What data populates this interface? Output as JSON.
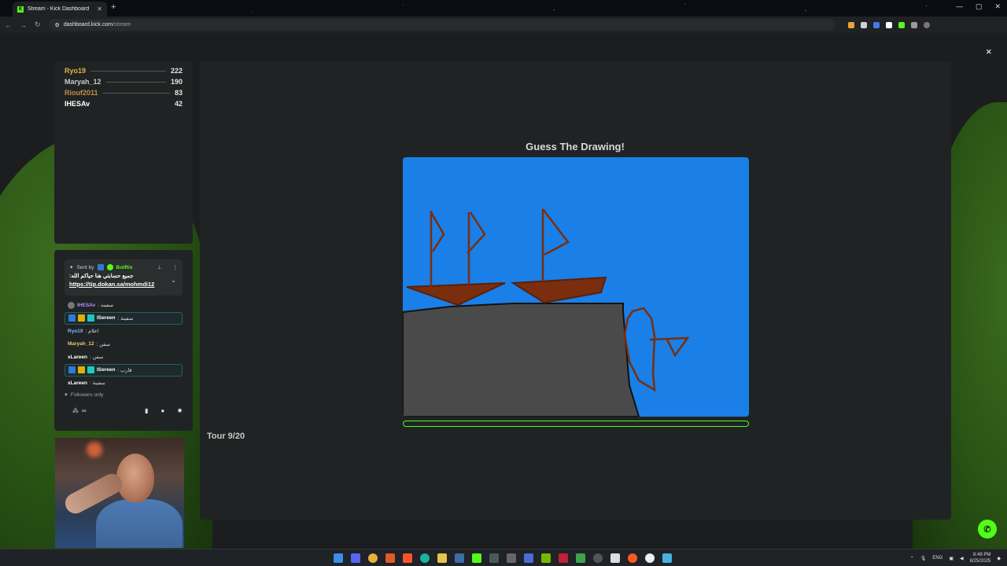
{
  "browser": {
    "tab_title": "Stream - Kick Dashboard",
    "new_tab": "+",
    "tab_close": "✕",
    "url_domain": "dashboard.kick.com",
    "url_path": "/stream",
    "window_controls": [
      "—",
      "▢",
      "✕"
    ]
  },
  "overlay": {
    "close_label": "×"
  },
  "leaderboard": [
    {
      "name": "Ryo19",
      "score": "222",
      "color": "#e0b44a"
    },
    {
      "name": "Maryah_12",
      "score": "190",
      "color": "#c9c9c9"
    },
    {
      "name": "Riouf2011",
      "score": "83",
      "color": "#c98a4a"
    },
    {
      "name": "IHESAv",
      "score": "42",
      "color": "#ffffff"
    }
  ],
  "chat": {
    "pinned": {
      "sent_by": "Sent by",
      "bot_name": "BotRix",
      "text": "جميع حسابتي هنا حياكم الله:",
      "link": "https://tip.dokan.sa/mohmdi12"
    },
    "messages": [
      {
        "user": "IHESAv",
        "text": ": سفينه",
        "color": "#b48cff",
        "highlight": false
      },
      {
        "user": "ISereen",
        "text": ": سفينة",
        "color": "#ffffff",
        "highlight": true
      },
      {
        "user": "Ryo19",
        "text": ": اعلام",
        "color": "#7fb6ff",
        "highlight": false
      },
      {
        "user": "Maryah_12",
        "text": ": سفن",
        "color": "#f0c27a",
        "highlight": false
      },
      {
        "user": "xLareen",
        "text": ": سفن",
        "color": "#ffffff",
        "highlight": false
      },
      {
        "user": "ISereen",
        "text": ": قارب",
        "color": "#ffffff",
        "highlight": true
      },
      {
        "user": "xLareen",
        "text": ": سفينة",
        "color": "#ffffff",
        "highlight": false
      }
    ],
    "followers_only": "Followers only",
    "infinity": "∞"
  },
  "game": {
    "title": "Guess The Drawing!",
    "round_label": "Tour 9/20",
    "timer_progress": 0.0,
    "canvas_color": "#1a7fe6"
  },
  "taskbar": {
    "time": "8:49 PM",
    "date": "8/25/2025",
    "lang": "ENG"
  }
}
